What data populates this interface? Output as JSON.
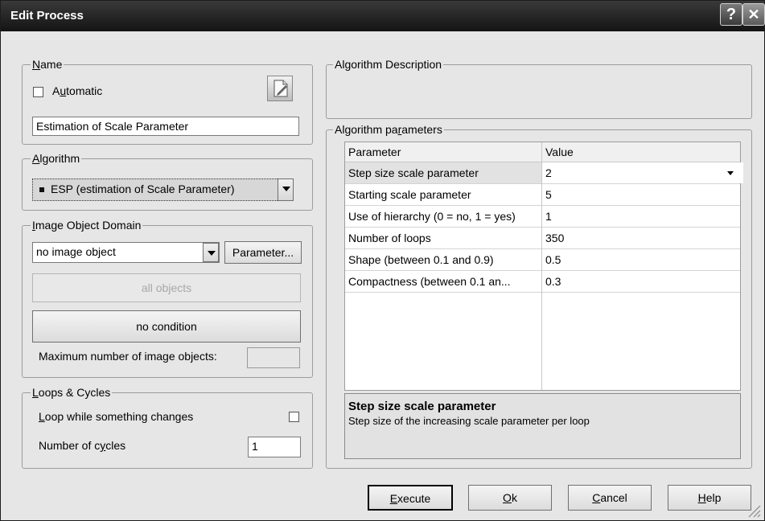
{
  "window": {
    "title": "Edit Process",
    "help_glyph": "?",
    "close_glyph": "✕"
  },
  "name_group": {
    "label": "Name",
    "automatic_label": "Automatic",
    "automatic_checked": false,
    "name_value": "Estimation of Scale Parameter",
    "edit_icon": "document-edit-icon"
  },
  "algorithm_group": {
    "label": "Algorithm",
    "selected": "ESP (estimation of Scale Parameter)"
  },
  "domain_group": {
    "label": "Image Object Domain",
    "domain_value": "no image object",
    "parameter_button": "Parameter...",
    "all_objects_button": "all objects",
    "no_condition_button": "no condition",
    "max_objects_label": "Maximum number of image objects:",
    "max_objects_value": ""
  },
  "loops_group": {
    "label": "Loops & Cycles",
    "loop_label": "Loop while something changes",
    "loop_checked": false,
    "cycles_label": "Number of cycles",
    "cycles_value": "1"
  },
  "description_group": {
    "label": "Algorithm Description",
    "text": ""
  },
  "params_group": {
    "label": "Algorithm parameters",
    "columns": [
      "Parameter",
      "Value"
    ],
    "rows": [
      {
        "param": "Step size scale parameter",
        "value": "2"
      },
      {
        "param": "Starting scale parameter",
        "value": "5"
      },
      {
        "param": "Use of hierarchy (0 = no, 1 = yes)",
        "value": "1"
      },
      {
        "param": "Number of loops",
        "value": "350"
      },
      {
        "param": "Shape (between 0.1 and 0.9)",
        "value": "0.5"
      },
      {
        "param": "Compactness (between 0.1 an...",
        "value": "0.3"
      }
    ],
    "help_title": "Step size scale parameter",
    "help_text": "Step size of the increasing scale parameter per loop"
  },
  "buttons": {
    "execute": "Execute",
    "ok": "Ok",
    "cancel": "Cancel",
    "help": "Help"
  },
  "colors": {
    "titlebar": "#1e1e1e",
    "dialog_bg": "#e6e6e6",
    "grid_bg": "#ffffff"
  }
}
